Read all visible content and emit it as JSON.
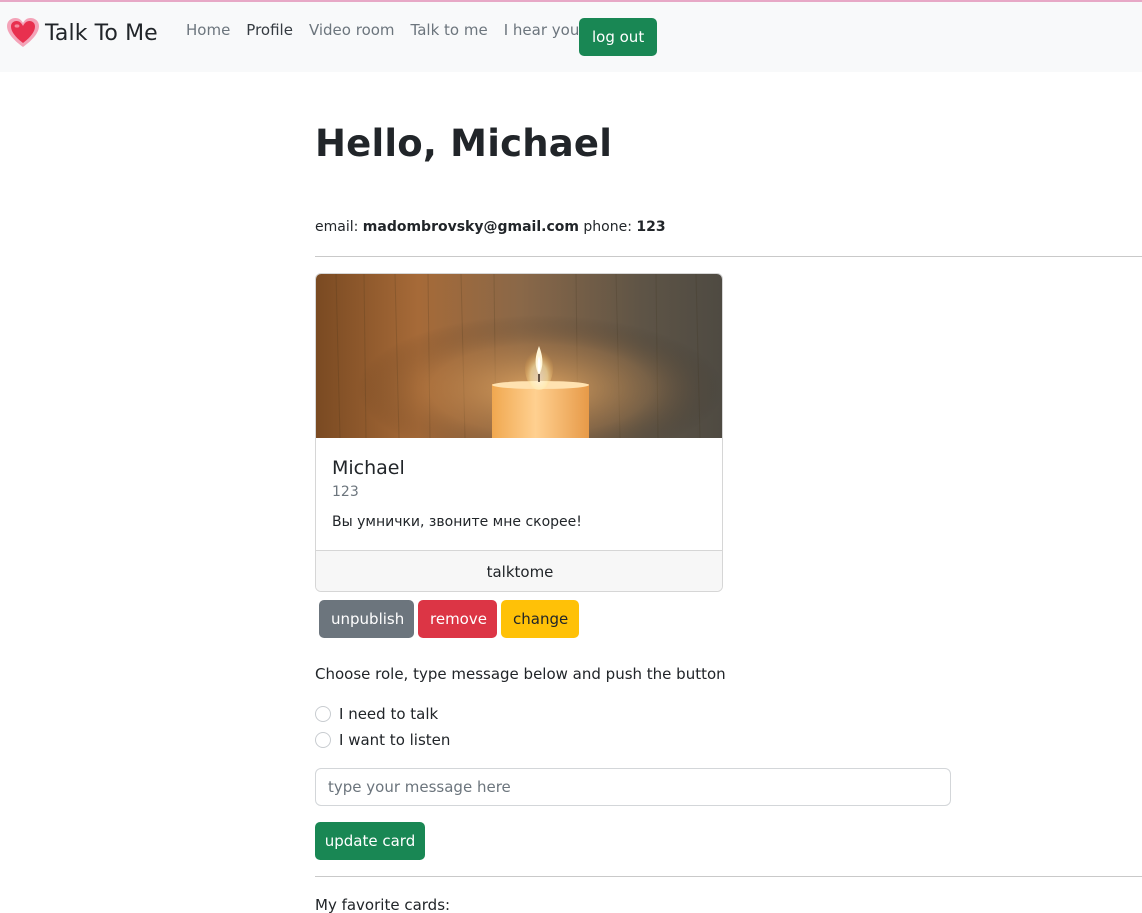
{
  "nav": {
    "brand": "Talk To Me",
    "links": [
      "Home",
      "Profile",
      "Video room",
      "Talk to me",
      "I hear you"
    ],
    "logout": "log out"
  },
  "profile": {
    "greeting": "Hello, Michael",
    "email_label": "email:",
    "email": "madombrovsky@gmail.com",
    "phone_label": "phone:",
    "phone": "123"
  },
  "card": {
    "title": "Michael",
    "subtitle": "123",
    "text": "Вы умнички, звоните мне скорее!",
    "footer": "talktome"
  },
  "card_actions": {
    "unpublish": "unpublish",
    "remove": "remove",
    "change": "change"
  },
  "form": {
    "instructions": "Choose role, type message below and push the button",
    "role_options": [
      "I need to talk",
      "I want to listen"
    ],
    "message_placeholder": "type your message here",
    "submit": "update card"
  },
  "favorites": {
    "label": "My favorite cards:"
  },
  "colors": {
    "success": "#198754",
    "secondary": "#6c757d",
    "danger": "#dc3545",
    "warning": "#ffc107"
  }
}
